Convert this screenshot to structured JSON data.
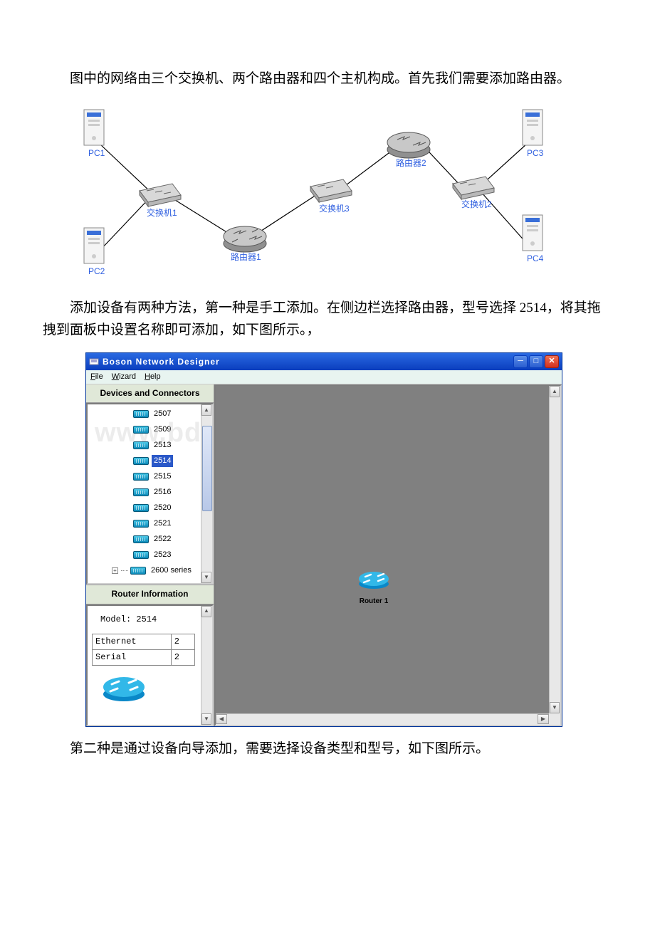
{
  "paragraphs": {
    "p1": "图中的网络由三个交换机、两个路由器和四个主机构成。首先我们需要添加路由器。",
    "p2": "添加设备有两种方法，第一种是手工添加。在侧边栏选择路由器，型号选择 2514，将其拖拽到面板中设置名称即可添加，如下图所示。，",
    "p3": "第二种是通过设备向导添加，需要选择设备类型和型号，如下图所示。"
  },
  "topology": {
    "pc1": "PC1",
    "pc2": "PC2",
    "pc3": "PC3",
    "pc4": "PC4",
    "sw1": "交换机1",
    "sw2": "交换机2",
    "sw3": "交换机3",
    "r1": "路由器1",
    "r2": "路由器2"
  },
  "app": {
    "title": "Boson Network Designer",
    "menu": {
      "file": "File",
      "wizard": "Wizard",
      "help": "Help"
    },
    "devices_header": "Devices and Connectors",
    "tree": {
      "m2507": "2507",
      "m2509": "2509",
      "m2513": "2513",
      "m2514": "2514",
      "m2515": "2515",
      "m2516": "2516",
      "m2520": "2520",
      "m2521": "2521",
      "m2522": "2522",
      "m2523": "2523",
      "series2600": "2600 series"
    },
    "info_header": "Router Information",
    "model_line": "Model: 2514",
    "info_rows": {
      "ethernet_label": "Ethernet",
      "ethernet_val": "2",
      "serial_label": "Serial",
      "serial_val": "2"
    },
    "canvas_router_label": "Router 1",
    "watermark": "www.bdocx.com"
  }
}
